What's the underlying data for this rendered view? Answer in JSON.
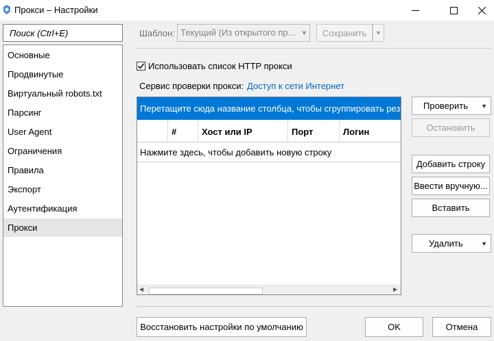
{
  "window": {
    "title": "Прокси – Настройки",
    "icons": [
      "app-spider-icon",
      "minimize-icon",
      "maximize-icon",
      "close-icon"
    ]
  },
  "search": {
    "placeholder": "Поиск (Ctrl+E)"
  },
  "sidebar": {
    "items": [
      {
        "label": "Основные"
      },
      {
        "label": "Продвинутые"
      },
      {
        "label": "Виртуальный robots.txt"
      },
      {
        "label": "Парсинг"
      },
      {
        "label": "User Agent"
      },
      {
        "label": "Ограничения"
      },
      {
        "label": "Правила"
      },
      {
        "label": "Экспорт"
      },
      {
        "label": "Аутентификация"
      },
      {
        "label": "Прокси"
      }
    ],
    "selected": "Прокси"
  },
  "template": {
    "label": "Шаблон:",
    "value": "Текущий (Из открытого пр...",
    "save_label": "Сохранить"
  },
  "proxy": {
    "use_list_label": "Использовать список HTTP прокси",
    "use_list_checked": true,
    "check_service_label": "Сервис проверки прокси:",
    "check_service_link": "Доступ к сети Интернет"
  },
  "grid": {
    "group_hint": "Перетащите сюда название столбца, чтобы сгруппировать резу",
    "columns": [
      "#",
      "Хост или IP",
      "Порт",
      "Логин"
    ],
    "new_row_hint": "Нажмите здесь, чтобы добавить новую строку"
  },
  "actions": {
    "check": "Проверить",
    "stop": "Остановить",
    "add_row": "Добавить строку",
    "enter_manually": "Ввести вручную...",
    "paste": "Вставить",
    "delete": "Удалить"
  },
  "footer": {
    "restore_defaults": "Восстановить настройки по умолчанию",
    "ok": "OK",
    "cancel": "Отмена"
  },
  "colors": {
    "accent": "#0078d7",
    "link": "#0066cc",
    "selected_item": "#e5e5e5"
  }
}
